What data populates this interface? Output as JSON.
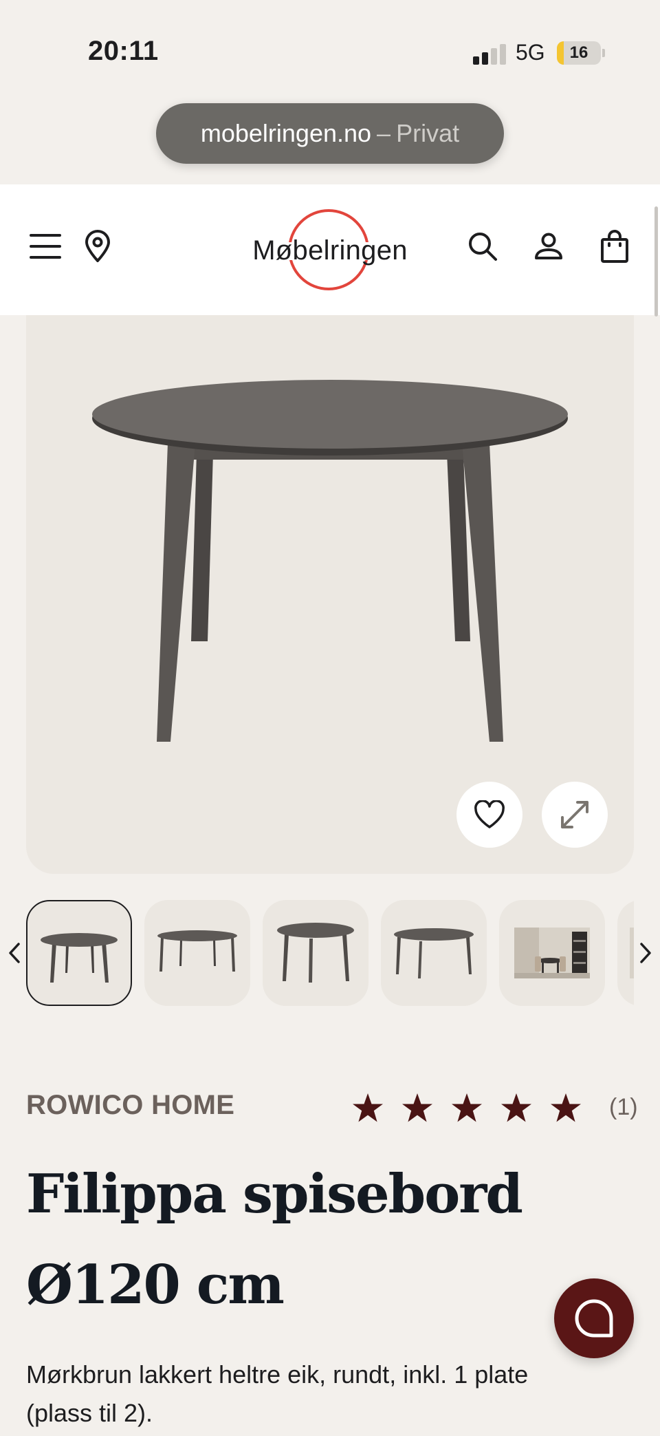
{
  "status_bar": {
    "time": "20:11",
    "network": "5G",
    "battery": "16",
    "battery_level_percent": 16,
    "signal_bars_active": 2,
    "signal_bars_total": 4
  },
  "browser": {
    "domain": "mobelringen.no",
    "separator": "–",
    "mode": "Privat"
  },
  "header": {
    "logo_text": "Møbelringen",
    "brand_color": "#e2453c",
    "icons": [
      "menu-icon",
      "location-pin-icon",
      "search-icon",
      "account-icon",
      "shopping-bag-icon"
    ]
  },
  "gallery": {
    "main_image": "dark brown round dining table",
    "actions": [
      "heart-icon",
      "expand-icon"
    ],
    "thumbnails": [
      {
        "alt": "round table front view",
        "selected": true
      },
      {
        "alt": "extended table side view",
        "selected": false
      },
      {
        "alt": "round table angled view",
        "selected": false
      },
      {
        "alt": "oval table view",
        "selected": false
      },
      {
        "alt": "table in dining room",
        "selected": false
      },
      {
        "alt": "more images",
        "selected": false
      }
    ]
  },
  "product": {
    "brand": "ROWICO HOME",
    "rating": 5,
    "rating_max": 5,
    "review_count": "(1)",
    "title": "Filippa spisebord Ø120 cm",
    "description": "Mørkbrun lakkert heltre eik, rundt, inkl. 1 plate (plass til 2).",
    "star_color": "#4a1414"
  },
  "chat": {
    "accent": "#5a1616",
    "icon": "chat-bubble-icon"
  }
}
